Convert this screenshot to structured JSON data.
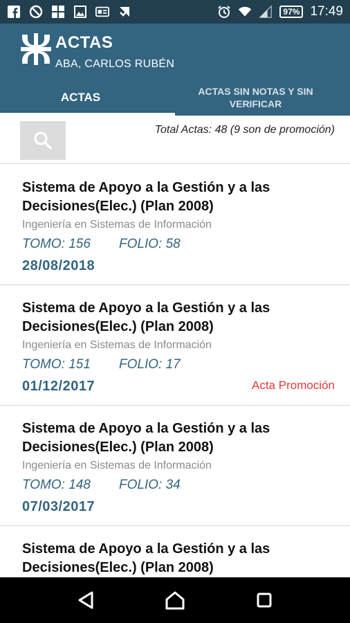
{
  "status_bar": {
    "battery": "97%",
    "time": "17:49",
    "icons": [
      "facebook-icon",
      "blocked-icon",
      "windows-icon",
      "image-icon",
      "card-icon",
      "check-icon",
      "alarm-icon",
      "wifi-icon",
      "signal-icon"
    ]
  },
  "app_bar": {
    "title": "ACTAS",
    "subtitle": "ABA, CARLOS RUBÉN"
  },
  "tabs": [
    {
      "label": "ACTAS",
      "selected": true
    },
    {
      "label": "ACTAS SIN NOTAS Y SIN VERIFICAR",
      "selected": false
    }
  ],
  "summary": {
    "total_text": "Total Actas: 48 (9 son de promoción)"
  },
  "actas": [
    {
      "title": "Sistema de Apoyo a la Gestión y a las Decisiones(Elec.) (Plan 2008)",
      "career": "Ingeniería en Sistemas de Información",
      "tomo": "TOMO: 156",
      "folio": "FOLIO: 58",
      "date": "28/08/2018",
      "promo": ""
    },
    {
      "title": "Sistema de Apoyo a la Gestión y a las Decisiones(Elec.) (Plan 2008)",
      "career": "Ingeniería en Sistemas de Información",
      "tomo": "TOMO: 151",
      "folio": "FOLIO: 17",
      "date": "01/12/2017",
      "promo": "Acta Promoción"
    },
    {
      "title": "Sistema de Apoyo a la Gestión y a las Decisiones(Elec.) (Plan 2008)",
      "career": "Ingeniería en Sistemas de Información",
      "tomo": "TOMO: 148",
      "folio": "FOLIO: 34",
      "date": "07/03/2017",
      "promo": ""
    },
    {
      "title": "Sistema de Apoyo a la Gestión y a las Decisiones(Elec.) (Plan 2008)",
      "career": "",
      "tomo": "",
      "folio": "",
      "date": "",
      "promo": ""
    }
  ],
  "colors": {
    "status_bar": "#213f4f",
    "primary": "#336480",
    "promo": "#e53935"
  }
}
